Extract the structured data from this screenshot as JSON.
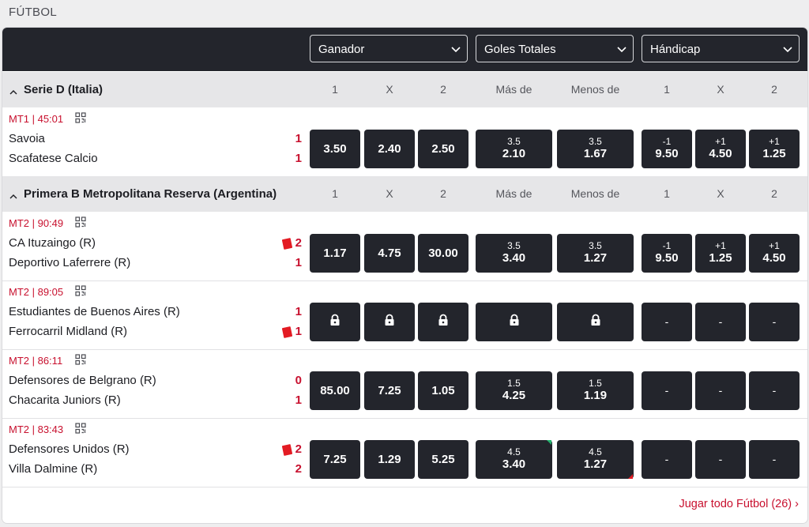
{
  "page": {
    "title": "FÚTBOL"
  },
  "markets": [
    {
      "label": "Ganador"
    },
    {
      "label": "Goles Totales"
    },
    {
      "label": "Hándicap"
    }
  ],
  "columns": [
    "1",
    "X",
    "2",
    "Más de",
    "Menos de",
    "1",
    "X",
    "2"
  ],
  "leagues": [
    {
      "name": "Serie D (Italia)",
      "events": [
        {
          "time": "MT1 | 45:01",
          "home": {
            "name": "Savoia",
            "score": "1",
            "red_card": false
          },
          "away": {
            "name": "Scafatese Calcio",
            "score": "1",
            "red_card": false
          },
          "winner": [
            "3.50",
            "2.40",
            "2.50"
          ],
          "totals": {
            "over": {
              "line": "3.5",
              "odd": "2.10"
            },
            "under": {
              "line": "3.5",
              "odd": "1.67"
            }
          },
          "handicap": [
            {
              "line": "-1",
              "odd": "9.50"
            },
            {
              "line": "+1",
              "odd": "4.50"
            },
            {
              "line": "+1",
              "odd": "1.25"
            }
          ]
        }
      ]
    },
    {
      "name": "Primera B Metropolitana Reserva (Argentina)",
      "events": [
        {
          "time": "MT2 | 90:49",
          "home": {
            "name": "CA Ituzaingo (R)",
            "score": "2",
            "red_card": true
          },
          "away": {
            "name": "Deportivo Laferrere (R)",
            "score": "1",
            "red_card": false
          },
          "winner": [
            "1.17",
            "4.75",
            "30.00"
          ],
          "totals": {
            "over": {
              "line": "3.5",
              "odd": "3.40"
            },
            "under": {
              "line": "3.5",
              "odd": "1.27"
            }
          },
          "handicap": [
            {
              "line": "-1",
              "odd": "9.50"
            },
            {
              "line": "+1",
              "odd": "1.25"
            },
            {
              "line": "+1",
              "odd": "4.50"
            }
          ]
        },
        {
          "time": "MT2 | 89:05",
          "home": {
            "name": "Estudiantes de Buenos Aires (R)",
            "score": "1",
            "red_card": false
          },
          "away": {
            "name": "Ferrocarril Midland (R)",
            "score": "1",
            "red_card": true
          },
          "locked": true,
          "handicap_empty": "-"
        },
        {
          "time": "MT2 | 86:11",
          "home": {
            "name": "Defensores de Belgrano (R)",
            "score": "0",
            "red_card": false
          },
          "away": {
            "name": "Chacarita Juniors (R)",
            "score": "1",
            "red_card": false
          },
          "winner": [
            "85.00",
            "7.25",
            "1.05"
          ],
          "totals": {
            "over": {
              "line": "1.5",
              "odd": "4.25"
            },
            "under": {
              "line": "1.5",
              "odd": "1.19"
            }
          },
          "handicap_empty": "-"
        },
        {
          "time": "MT2 | 83:43",
          "home": {
            "name": "Defensores Unidos (R)",
            "score": "2",
            "red_card": true
          },
          "away": {
            "name": "Villa Dalmine (R)",
            "score": "2",
            "red_card": false
          },
          "winner": [
            "7.25",
            "1.29",
            "5.25"
          ],
          "totals": {
            "over": {
              "line": "4.5",
              "odd": "3.40",
              "trend": "up"
            },
            "under": {
              "line": "4.5",
              "odd": "1.27",
              "trend": "down"
            }
          },
          "handicap_empty": "-"
        }
      ]
    }
  ],
  "footer": {
    "link": "Jugar todo Fútbol (26) ›"
  },
  "colors": {
    "dark": "#23252c",
    "accent_red": "#c8102e",
    "league_bg": "#e6e6e8",
    "up": "#21b26d",
    "down": "#e31b23"
  }
}
